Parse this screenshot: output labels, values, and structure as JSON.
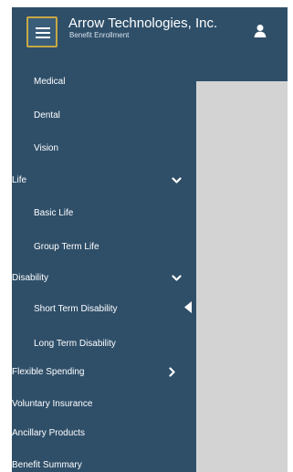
{
  "header": {
    "company_name": "Arrow Technologies, Inc.",
    "subtitle": "Benefit Enrollment",
    "menu_icon": "hamburger-icon",
    "user_icon": "user-icon"
  },
  "sidebar": {
    "items": [
      {
        "label": "Medical"
      },
      {
        "label": "Dental"
      },
      {
        "label": "Vision"
      },
      {
        "label": "Life",
        "expanded": true
      },
      {
        "label": "Basic Life"
      },
      {
        "label": "Group Term Life"
      },
      {
        "label": "Disability",
        "expanded": true
      },
      {
        "label": "Short Term Disability",
        "active": true
      },
      {
        "label": "Long Term Disability"
      },
      {
        "label": "Flexible Spending",
        "expanded": false
      },
      {
        "label": "Voluntary Insurance"
      },
      {
        "label": "Ancillary Products"
      },
      {
        "label": "Benefit Summary"
      }
    ]
  },
  "colors": {
    "brand": "#2f4f69",
    "menu_button_border": "#c7a845",
    "content_background": "#d3d3d3"
  }
}
